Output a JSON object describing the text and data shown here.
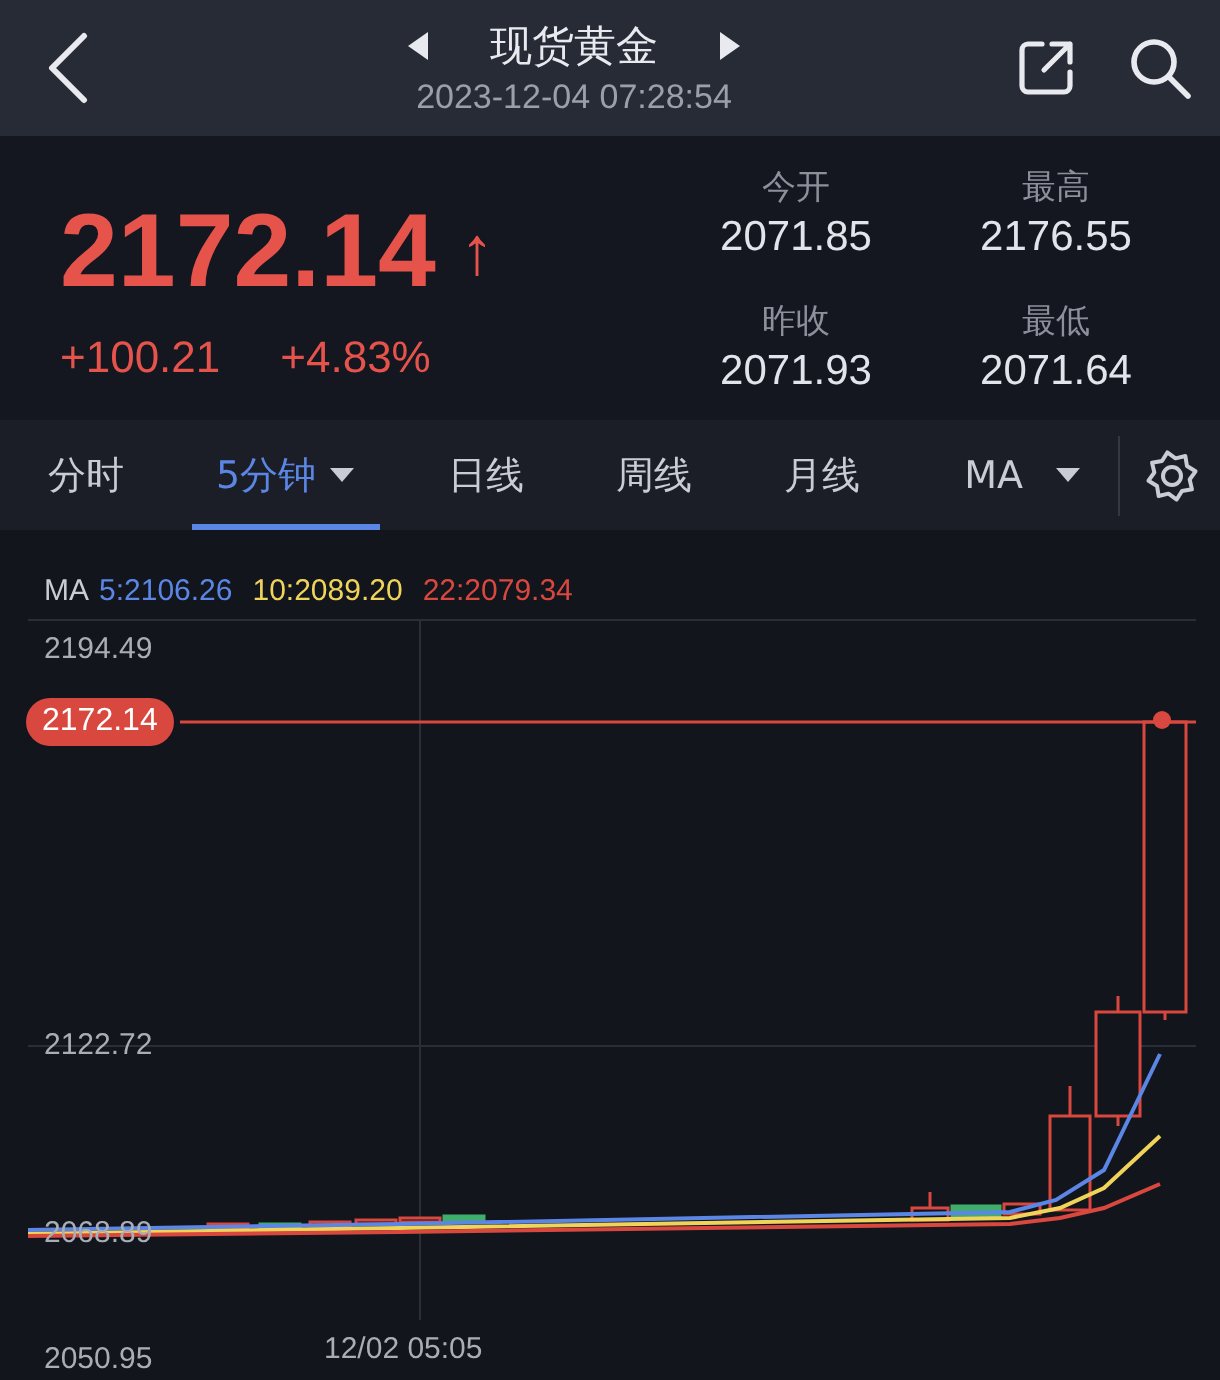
{
  "header": {
    "title": "现货黄金",
    "datetime": "2023-12-04 07:28:54"
  },
  "quote": {
    "price": "2172.14",
    "arrow": "↑",
    "change": "+100.21",
    "change_percent": "+4.83%"
  },
  "stats": [
    {
      "label": "今开",
      "value": "2071.85"
    },
    {
      "label": "最高",
      "value": "2176.55"
    },
    {
      "label": "昨收",
      "value": "2071.93"
    },
    {
      "label": "最低",
      "value": "2071.64"
    }
  ],
  "tabs": [
    {
      "label": "分时",
      "selected": false,
      "dropdown": false
    },
    {
      "label": "5分钟",
      "selected": true,
      "dropdown": true
    },
    {
      "label": "日线",
      "selected": false,
      "dropdown": false
    },
    {
      "label": "周线",
      "selected": false,
      "dropdown": false
    },
    {
      "label": "月线",
      "selected": false,
      "dropdown": false
    }
  ],
  "indicator": {
    "label": "MA",
    "dropdown": true
  },
  "chart": {
    "legend_label": "MA",
    "ma": [
      {
        "text": "5:2106.26",
        "color": "#5b86e5"
      },
      {
        "text": "10:2089.20",
        "color": "#f0d45a"
      },
      {
        "text": "22:2079.34",
        "color": "#d9483f"
      }
    ],
    "y_labels": [
      "2194.49",
      "2122.72",
      "2068.89",
      "2050.95"
    ],
    "x_label": "12/02 05:05",
    "current_price": "2172.14"
  }
}
